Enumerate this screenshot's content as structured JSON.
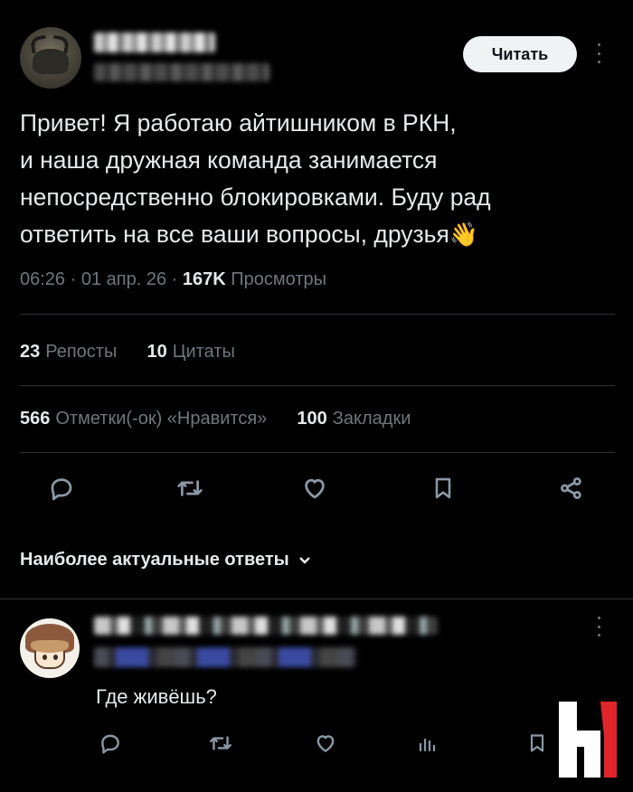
{
  "post": {
    "follow_label": "Читать",
    "text_lines": [
      "Привет! Я работаю айтишником в РКН,",
      "и наша дружная команда занимается",
      "непосредственно блокировками. Буду рад",
      "ответить на все ваши вопросы, друзья"
    ],
    "emoji": "👋",
    "time": "06:26",
    "date": "01 апр. 26",
    "views_count": "167K",
    "views_label": "Просмотры",
    "separator": "·"
  },
  "stats": {
    "reposts_count": "23",
    "reposts_label": "Репосты",
    "quotes_count": "10",
    "quotes_label": "Цитаты",
    "likes_count": "566",
    "likes_label": "Отметки(-ок) «Нравится»",
    "bookmarks_count": "100",
    "bookmarks_label": "Закладки"
  },
  "replies": {
    "sort_label": "Наиболее актуальные ответы",
    "items": [
      {
        "text": "Где живёшь?"
      }
    ]
  },
  "icons": {
    "reply": "reply-icon",
    "repost": "repost-icon",
    "like": "like-icon",
    "bookmark": "bookmark-icon",
    "share": "share-icon",
    "views": "views-icon"
  },
  "colors": {
    "background": "#000000",
    "text": "#e7e9ea",
    "muted": "#71767b",
    "divider": "#2f3336",
    "button_bg": "#eff3f4"
  }
}
